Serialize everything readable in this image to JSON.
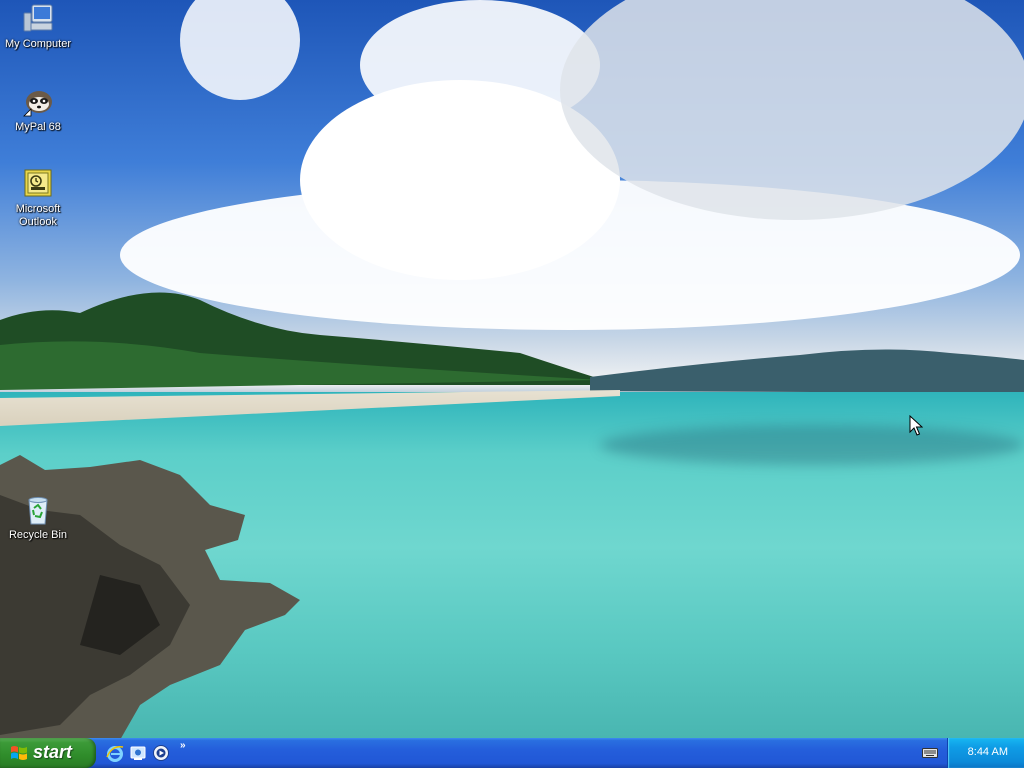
{
  "desktop": {
    "icons": [
      {
        "label": "My Computer",
        "icon": "my-computer-icon"
      },
      {
        "label": "MyPal 68",
        "icon": "mypal-raccoon-icon"
      },
      {
        "label": "Microsoft Outlook",
        "icon": "outlook-icon"
      },
      {
        "label": "Recycle Bin",
        "icon": "recycle-bin-icon"
      }
    ],
    "wallpaper": "tropical-beach"
  },
  "taskbar": {
    "start_label": "start",
    "quick_launch": [
      {
        "icon": "internet-explorer-icon"
      },
      {
        "icon": "show-desktop-icon"
      },
      {
        "icon": "media-player-icon"
      }
    ],
    "chevron": "»",
    "tray": {
      "icons": [
        "keyboard-icon"
      ],
      "clock": "8:44 AM"
    }
  },
  "colors": {
    "taskbar": "#245edb",
    "start_button": "#2f8c2a",
    "tray": "#0f9de6"
  }
}
